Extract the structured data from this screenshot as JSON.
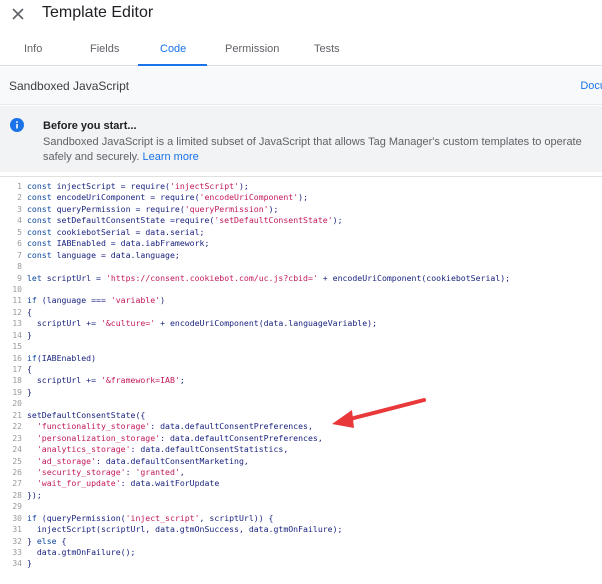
{
  "window": {
    "title": "Template Editor"
  },
  "tabs": [
    {
      "label": "Info"
    },
    {
      "label": "Fields"
    },
    {
      "label": "Code"
    },
    {
      "label": "Permission"
    },
    {
      "label": "Tests"
    }
  ],
  "section": {
    "title": "Sandboxed JavaScript",
    "doc_link": "Docu"
  },
  "info": {
    "heading": "Before you start...",
    "text": "Sandboxed JavaScript is a limited subset of JavaScript that allows Tag Manager's custom templates to operate safely and securely. ",
    "link": "Learn more"
  },
  "colors": {
    "accent": "#1a73e8",
    "arrow": "#e8383a"
  },
  "code_lines": [
    {
      "n": "1",
      "text": "const injectScript = require('injectScript');"
    },
    {
      "n": "2",
      "text": "const encodeUriComponent = require('encodeUriComponent');"
    },
    {
      "n": "3",
      "text": "const queryPermission = require('queryPermission');"
    },
    {
      "n": "4",
      "text": "const setDefaultConsentState =require('setDefaultConsentState');"
    },
    {
      "n": "5",
      "text": "const cookiebotSerial = data.serial;"
    },
    {
      "n": "6",
      "text": "const IABEnabled = data.iabFramework;"
    },
    {
      "n": "7",
      "text": "const language = data.language;"
    },
    {
      "n": "8",
      "text": ""
    },
    {
      "n": "9",
      "text": "let scriptUrl = 'https://consent.cookiebot.com/uc.js?cbid=' + encodeUriComponent(cookiebotSerial);"
    },
    {
      "n": "10",
      "text": ""
    },
    {
      "n": "11",
      "text": "if (language === 'variable')"
    },
    {
      "n": "12",
      "text": "{"
    },
    {
      "n": "13",
      "text": "  scriptUrl += '&culture=' + encodeUriComponent(data.languageVariable);"
    },
    {
      "n": "14",
      "text": "}"
    },
    {
      "n": "15",
      "text": ""
    },
    {
      "n": "16",
      "text": "if(IABEnabled)"
    },
    {
      "n": "17",
      "text": "{"
    },
    {
      "n": "18",
      "text": "  scriptUrl += '&framework=IAB';"
    },
    {
      "n": "19",
      "text": "}"
    },
    {
      "n": "20",
      "text": ""
    },
    {
      "n": "21",
      "text": "setDefaultConsentState({"
    },
    {
      "n": "22",
      "text": "  'functionality_storage': data.defaultConsentPreferences,"
    },
    {
      "n": "23",
      "text": "  'personalization_storage': data.defaultConsentPreferences,"
    },
    {
      "n": "24",
      "text": "  'analytics_storage': data.defaultConsentStatistics,"
    },
    {
      "n": "25",
      "text": "  'ad_storage': data.defaultConsentMarketing,"
    },
    {
      "n": "26",
      "text": "  'security_storage': 'granted',"
    },
    {
      "n": "27",
      "text": "  'wait_for_update': data.waitForUpdate"
    },
    {
      "n": "28",
      "text": "});"
    },
    {
      "n": "29",
      "text": ""
    },
    {
      "n": "30",
      "text": "if (queryPermission('inject_script', scriptUrl)) {"
    },
    {
      "n": "31",
      "text": "  injectScript(scriptUrl, data.gtmOnSuccess, data.gtmOnFailure);"
    },
    {
      "n": "32",
      "text": "} else {"
    },
    {
      "n": "33",
      "text": "  data.gtmOnFailure();"
    },
    {
      "n": "34",
      "text": "}"
    }
  ]
}
